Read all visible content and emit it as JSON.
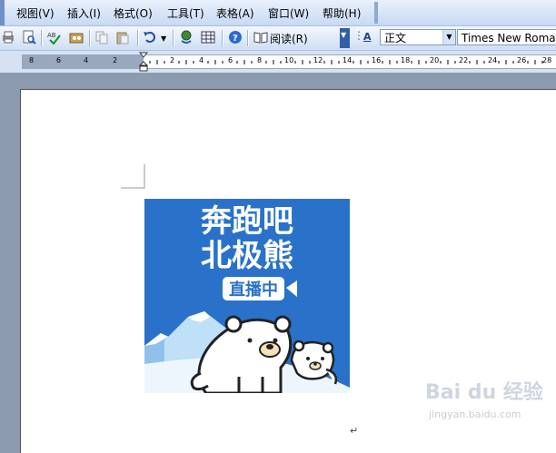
{
  "menubar": {
    "items": [
      "视图(V)",
      "插入(I)",
      "格式(O)",
      "工具(T)",
      "表格(A)",
      "窗口(W)",
      "帮助(H)"
    ]
  },
  "toolbar": {
    "read_label": "阅读(R)",
    "style_value": "正文",
    "font_value": "Times New Roman",
    "font_color_label": "A"
  },
  "ruler": {
    "left_numbers": [
      "8",
      "6",
      "4",
      "2"
    ],
    "right_numbers": [
      "2",
      "4",
      "6",
      "8",
      "10",
      "12",
      "14",
      "16",
      "18",
      "20",
      "22",
      "24",
      "26",
      "28"
    ]
  },
  "image": {
    "title_line1": "奔跑吧",
    "title_line2": "北极熊",
    "badge": "直播中",
    "bg_color": "#2a72c9"
  },
  "paragraph_mark": "↵",
  "watermark": {
    "logo": "Bai du 经验",
    "url": "jingyan.baidu.com"
  }
}
